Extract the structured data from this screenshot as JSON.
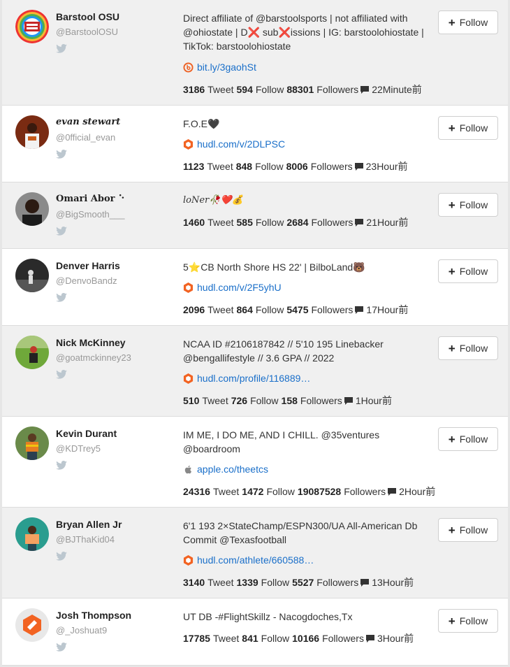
{
  "follow_label": "Follow",
  "users": [
    {
      "name": "Barstool OSU",
      "handle": "@BarstoolOSU",
      "description": "Direct affiliate of @barstoolsports | not affiliated with @ohiostate | D❌ sub❌issions | IG: barstoolohiostate | TikTok: barstoolohiostate",
      "link": "bit.ly/3gaohSt",
      "link_icon": "bitly-icon",
      "tweets": "3186",
      "tweet_label": "Tweet",
      "follows": "594",
      "follow_label": "Follow",
      "followers": "88301",
      "followers_label": "Followers",
      "time": "22Minute前"
    },
    {
      "name": "evan stewart",
      "handle": "@0fficial_evan",
      "description": "F.O.E🖤",
      "link": "hudl.com/v/2DLPSC",
      "link_icon": "hudl-icon",
      "tweets": "1123",
      "tweet_label": "Tweet",
      "follows": "848",
      "follow_label": "Follow",
      "followers": "8006",
      "followers_label": "Followers",
      "time": "23Hour前"
    },
    {
      "name": "Omari Abor ⠑",
      "handle": "@BigSmooth___",
      "description": "loNer🥀❤️💰",
      "link": "",
      "link_icon": "",
      "tweets": "1460",
      "tweet_label": "Tweet",
      "follows": "585",
      "follow_label": "Follow",
      "followers": "2684",
      "followers_label": "Followers",
      "time": "21Hour前"
    },
    {
      "name": "Denver Harris",
      "handle": "@DenvoBandz",
      "description": "5⭐CB North Shore HS 22' | BilboLand🐻",
      "link": "hudl.com/v/2F5yhU",
      "link_icon": "hudl-icon",
      "tweets": "2096",
      "tweet_label": "Tweet",
      "follows": "864",
      "follow_label": "Follow",
      "followers": "5475",
      "followers_label": "Followers",
      "time": "17Hour前"
    },
    {
      "name": "Nick McKinney",
      "handle": "@goatmckinney23",
      "description": "NCAA ID #2106187842 // 5'10 195 Linebacker @bengallifestyle // 3.6 GPA // 2022",
      "link": "hudl.com/profile/116889…",
      "link_icon": "hudl-icon",
      "tweets": "510",
      "tweet_label": "Tweet",
      "follows": "726",
      "follow_label": "Follow",
      "followers": "158",
      "followers_label": "Followers",
      "time": "1Hour前"
    },
    {
      "name": "Kevin Durant",
      "handle": "@KDTrey5",
      "description": "IM ME, I DO ME, AND I CHILL. @35ventures @boardroom",
      "link": "apple.co/theetcs",
      "link_icon": "apple-icon",
      "tweets": "24316",
      "tweet_label": "Tweet",
      "follows": "1472",
      "follow_label": "Follow",
      "followers": "19087528",
      "followers_label": "Followers",
      "time": "2Hour前"
    },
    {
      "name": "Bryan Allen Jr",
      "handle": "@BJThaKid04",
      "description": "6'1 193 2×StateChamp/ESPN300/UA All-American Db Commit @Texasfootball",
      "link": "hudl.com/athlete/660588…",
      "link_icon": "hudl-icon",
      "tweets": "3140",
      "tweet_label": "Tweet",
      "follows": "1339",
      "follow_label": "Follow",
      "followers": "5527",
      "followers_label": "Followers",
      "time": "13Hour前"
    },
    {
      "name": "Josh Thompson",
      "handle": "@_Joshuat9",
      "description": "UT DB -#FlightSkillz - Nacogdoches,Tx",
      "link": "",
      "link_icon": "",
      "tweets": "17785",
      "tweet_label": "Tweet",
      "follows": "841",
      "follow_label": "Follow",
      "followers": "10166",
      "followers_label": "Followers",
      "time": "3Hour前"
    }
  ]
}
